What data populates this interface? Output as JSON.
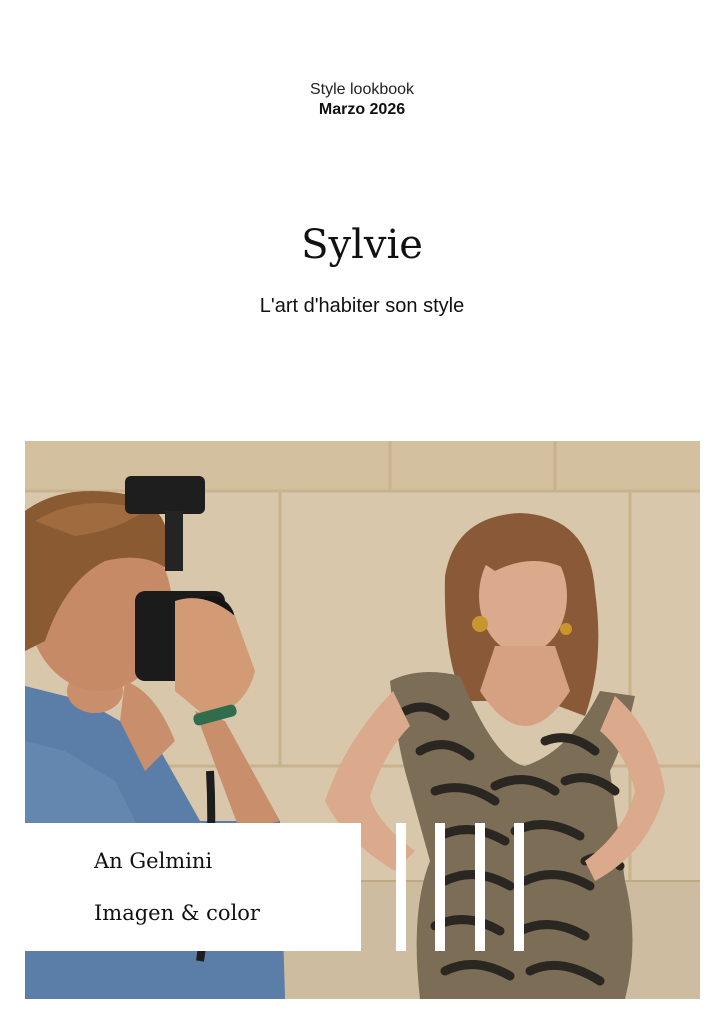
{
  "header": {
    "kicker": "Style lookbook",
    "date": "Marzo 2026"
  },
  "title": "Sylvie",
  "subtitle": "L'art d'habiter son style",
  "photo": {
    "subject": "photographer-and-model-photo"
  },
  "caption": {
    "author": "An Gelmini",
    "role": "Imagen & color"
  },
  "colors": {
    "background": "#ffffff",
    "text": "#111111",
    "wall": "#d9c8ad"
  }
}
